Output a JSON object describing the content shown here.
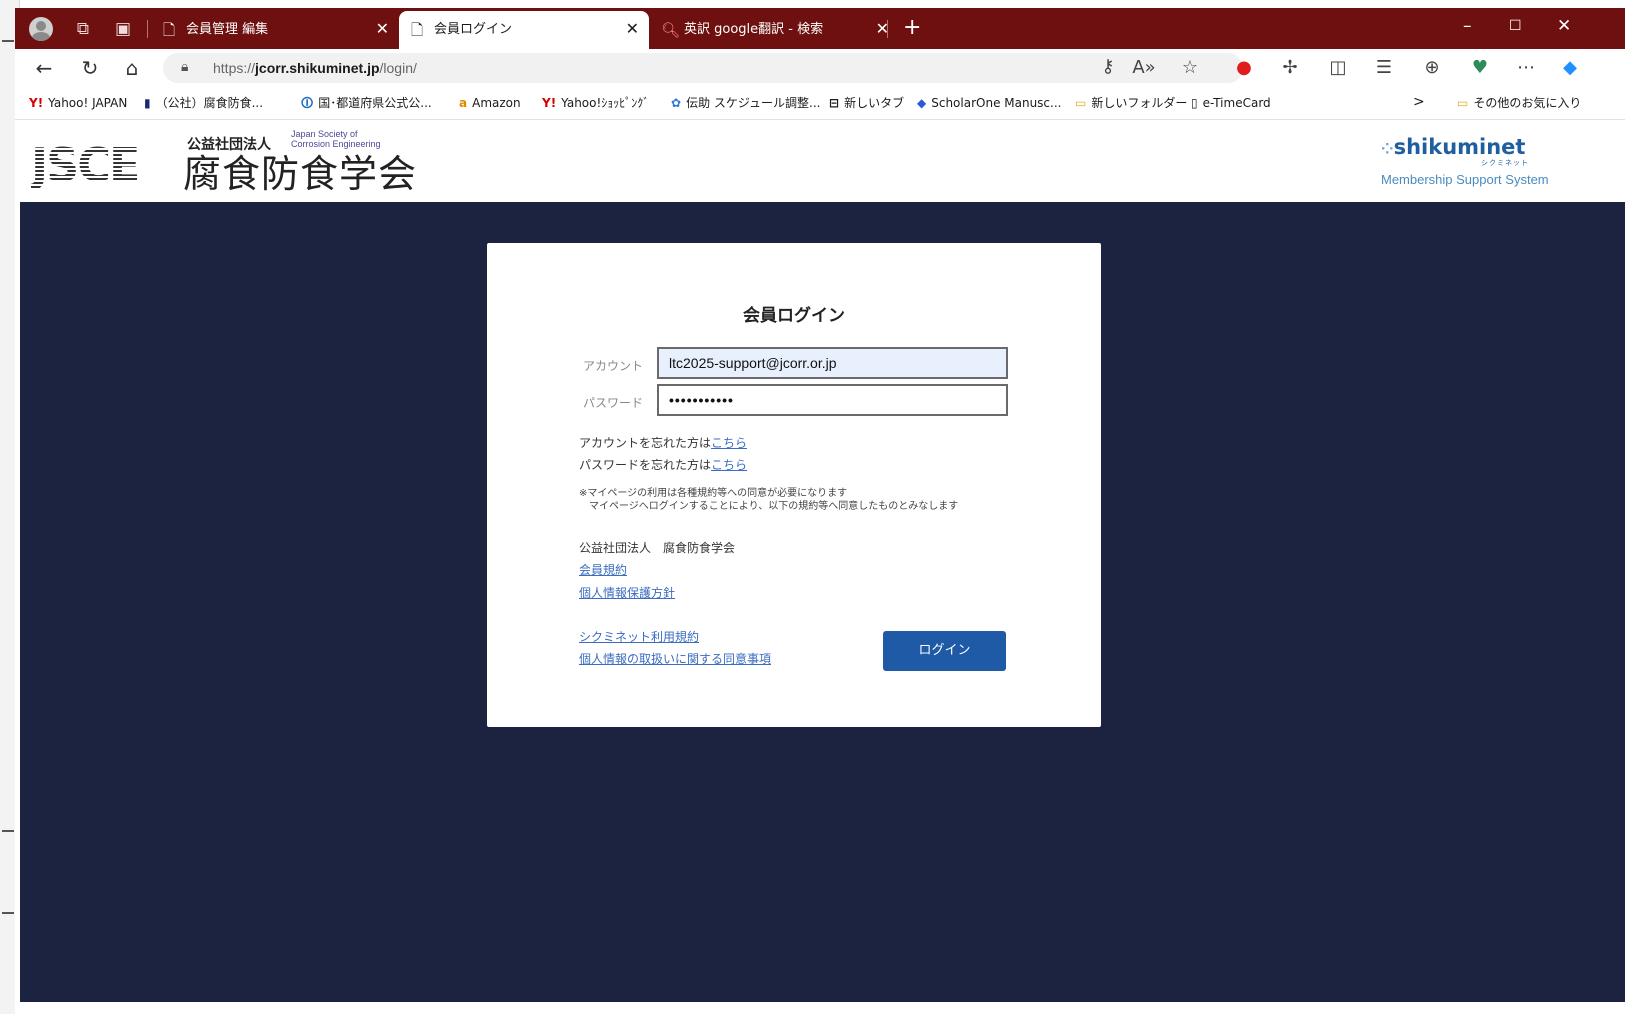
{
  "browser": {
    "tabs": [
      {
        "title": "会員管理 編集",
        "close": "✕"
      },
      {
        "title": "会員ログイン",
        "close": "✕"
      },
      {
        "title": "英訳 google翻訳 - 検索",
        "close": "✕"
      }
    ],
    "new_tab": "+",
    "window_controls": {
      "minimize": "–",
      "maximize": "☐",
      "close": "✕"
    },
    "url_prefix": "https://",
    "url_domain": "jcorr.shikuminet.jp",
    "url_path": "/login/",
    "bookmarks": [
      {
        "icon": "Y!",
        "label": "Yahoo! JAPAN"
      },
      {
        "icon": "▮",
        "label": "（公社）腐食防食..."
      },
      {
        "icon": "🛈",
        "label": "国･都道府県公式公..."
      },
      {
        "icon": "a",
        "label": "Amazon"
      },
      {
        "icon": "Y!",
        "label": "Yahoo!ｼｮｯﾋﾟﾝｸﾞ"
      },
      {
        "icon": "✿",
        "label": "伝助 スケジュール調整..."
      },
      {
        "icon": "⊟",
        "label": "新しいタブ"
      },
      {
        "icon": "◆",
        "label": "ScholarOne Manusc..."
      },
      {
        "icon": "▭",
        "label": "新しいフォルダー"
      },
      {
        "icon": "▯",
        "label": "e-TimeCard"
      }
    ],
    "bookmarks_more": ">",
    "other_favorites": "その他のお気に入り"
  },
  "site": {
    "logo": "JSCE",
    "org_type": "公益社団法人",
    "org_english": "Japan Society of\nCorrosion Engineering",
    "org_name": "腐食防食学会",
    "system_logo": "shikuminet",
    "system_logo_kana": "シクミネット",
    "system_subtitle": "Membership Support System"
  },
  "login": {
    "title": "会員ログイン",
    "account_label": "アカウント",
    "account_value": "ltc2025-support@jcorr.or.jp",
    "password_label": "パスワード",
    "password_value": "•••••••••••",
    "forgot_account_text": "アカウントを忘れた方は",
    "forgot_password_text": "パスワードを忘れた方は",
    "forgot_link": "こちら",
    "note_line1": "※マイページの利用は各種規約等への同意が必要になります",
    "note_line2": "　マイページへログインすることにより、以下の規約等へ同意したものとみなします",
    "org_label": "公益社団法人　腐食防食学会",
    "link_member_terms": "会員規約",
    "link_privacy": "個人情報保護方針",
    "link_shikuminet_terms": "シクミネット利用規約",
    "link_personal_info_consent": "個人情報の取扱いに関する同意事項",
    "login_button": "ログイン"
  }
}
